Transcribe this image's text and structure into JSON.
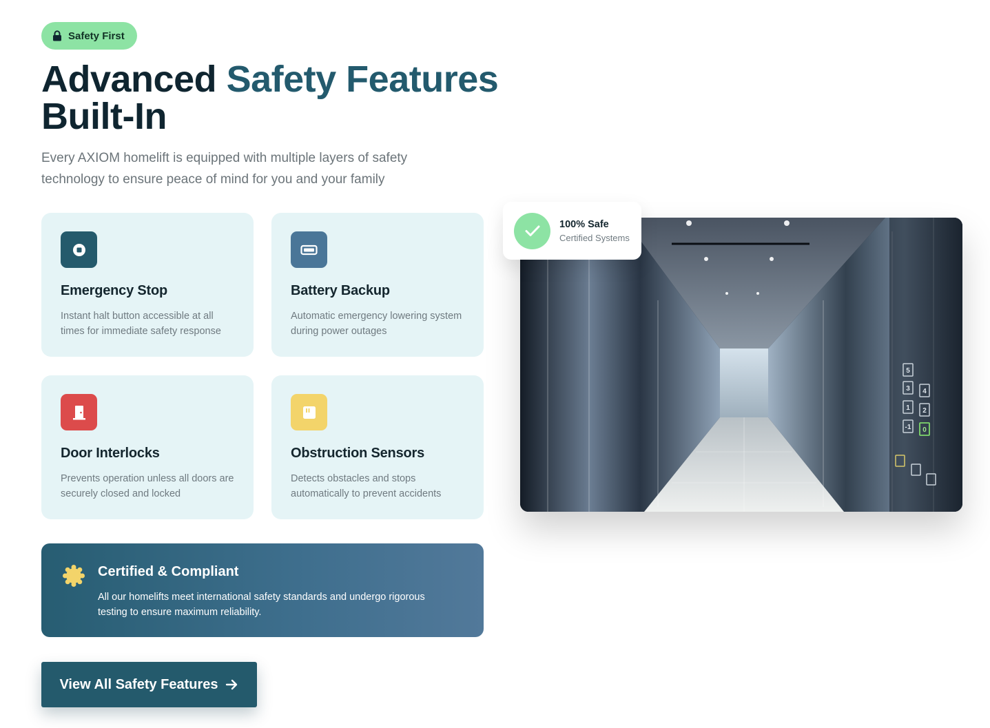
{
  "badge": {
    "label": "Safety First",
    "icon": "lock-icon",
    "color": "#8de3a4"
  },
  "headline": {
    "part1": "Advanced ",
    "accent": "Safety Features",
    "part2": "Built-In",
    "accent_color": "#235a6d"
  },
  "subtitle": "Every AXIOM homelift is equipped with multiple layers of safety technology to ensure peace of mind for you and your family",
  "features": [
    {
      "title": "Emergency Stop",
      "desc": "Instant halt button accessible at all times for immediate safety response",
      "icon": "stop-icon",
      "color": "#245a6c"
    },
    {
      "title": "Battery Backup",
      "desc": "Automatic emergency lowering system during power outages",
      "icon": "battery-icon",
      "color": "#4a7698"
    },
    {
      "title": "Door Interlocks",
      "desc": "Prevents operation unless all doors are securely closed and locked",
      "icon": "door-icon",
      "color": "#dc4b4b"
    },
    {
      "title": "Obstruction Sensors",
      "desc": "Detects obstacles and stops automatically to prevent accidents",
      "icon": "sensor-icon",
      "color": "#f3d46a"
    }
  ],
  "certified": {
    "title": "Certified & Compliant",
    "desc": "All our homelifts meet international safety standards and undergo rigorous testing to ensure maximum reliability.",
    "icon": "seal-icon"
  },
  "cta": {
    "label": "View All Safety Features",
    "icon": "arrow-right-icon"
  },
  "safe_badge": {
    "title": "100% Safe",
    "subtitle": "Certified Systems",
    "icon": "check-icon"
  },
  "elevator_buttons": [
    "5",
    "3",
    "4",
    "1",
    "2",
    "-1",
    "0"
  ]
}
